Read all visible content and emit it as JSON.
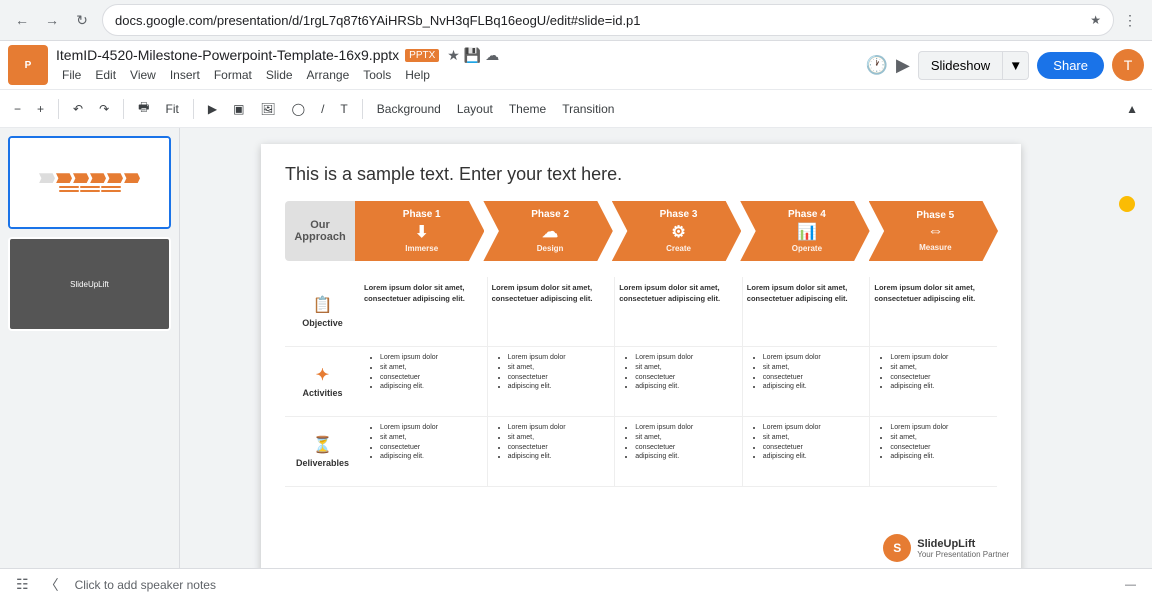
{
  "browser": {
    "url": "docs.google.com/presentation/d/1rgL7q87t6YAiHRSb_NvH3qFLBq16eogU/edit#slide=id.p1",
    "tab_title": "ItemID-4520-Milestone-Powerpoint-Template-16x9.pptx",
    "pptx_badge": "PPTX"
  },
  "header": {
    "filename": "ItemID-4520-Milestone-Powerpoint-Template-16x9.pptx",
    "pptx_label": "PPTX",
    "menu_items": [
      "File",
      "Edit",
      "View",
      "Insert",
      "Format",
      "Slide",
      "Arrange",
      "Tools",
      "Help"
    ],
    "slideshow_btn": "Slideshow",
    "share_btn": "Share",
    "avatar": "T"
  },
  "slide_toolbar": {
    "items": [
      "Background",
      "Layout",
      "Theme",
      "Transition"
    ]
  },
  "format_toolbar": {
    "zoom_label": "Fit"
  },
  "slide1": {
    "title": "This is a sample text. Enter your text here.",
    "our_approach": "Our\nApproach",
    "phases": [
      {
        "label": "Phase 1",
        "icon": "⬇",
        "sublabel": "Immerse"
      },
      {
        "label": "Phase 2",
        "icon": "☁",
        "sublabel": "Design"
      },
      {
        "label": "Phase 3",
        "icon": "⚙",
        "sublabel": "Create"
      },
      {
        "label": "Phase 4",
        "icon": "📊",
        "sublabel": "Operate"
      },
      {
        "label": "Phase 5",
        "icon": "⇔",
        "sublabel": "Measure"
      }
    ],
    "rows": [
      {
        "label": "Objective",
        "icon": "📋",
        "cells": [
          "Lorem ipsum dolor sit amet, consectetuer adipiscing elit.",
          "Lorem ipsum dolor sit amet, consectetuer adipiscing elit.",
          "Lorem ipsum dolor sit amet, consectetuer adipiscing elit.",
          "Lorem ipsum dolor sit amet, consectetuer adipiscing elit.",
          "Lorem ipsum dolor sit amet, consectetuer adipiscing elit."
        ]
      },
      {
        "label": "Activities",
        "icon": "✦",
        "cells": [
          "• Lorem ipsum dolor\n• sit amet,\n• consectetuer\n• adipiscing elit.",
          "• Lorem ipsum dolor\n• sit amet,\n• consectetuer\n• adipiscing elit.",
          "• Lorem ipsum dolor\n• sit amet,\n• consectetuer\n• adipiscing elit.",
          "• Lorem ipsum dolor\n• sit amet,\n• consectetuer\n• adipiscing elit.",
          "• Lorem ipsum dolor\n• sit amet,\n• consectetuer\n• adipiscing elit."
        ]
      },
      {
        "label": "Deliverables",
        "icon": "⏳",
        "cells": [
          "• Lorem ipsum dolor\n• sit amet,\n• consectetuer\n• adipiscing elit.",
          "• Lorem ipsum dolor\n• sit amet,\n• consectetuer\n• adipiscing elit.",
          "• Lorem ipsum dolor\n• sit amet,\n• consectetuer\n• adipiscing elit.",
          "• Lorem ipsum dolor\n• sit amet,\n• consectetuer\n• adipiscing elit.",
          "• Lorem ipsum dolor\n• sit amet,\n• consectetuer\n• adipiscing elit."
        ]
      }
    ]
  },
  "slideuplift": {
    "name": "SlideUpLift",
    "tagline": "Your Presentation Partner"
  },
  "bottom_bar": {
    "notes_placeholder": "Click to add speaker notes"
  },
  "slide2_label": "SlideUpLift"
}
